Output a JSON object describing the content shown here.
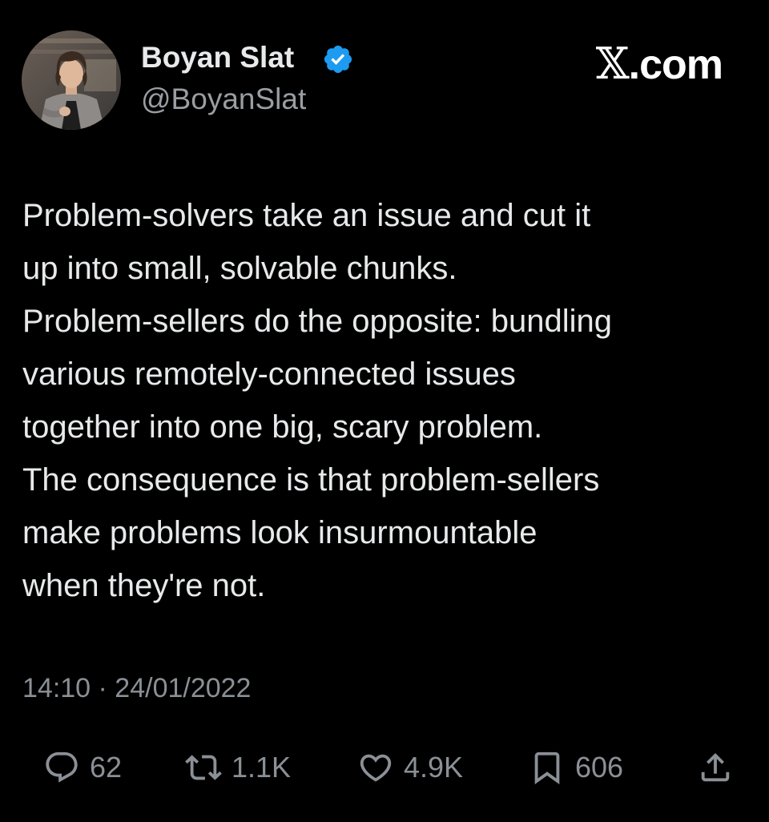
{
  "author": {
    "display_name": "Boyan Slat",
    "handle": "@BoyanSlat",
    "verified": true
  },
  "brand": {
    "logo_letter": "𝕏",
    "domain_suffix": ".com"
  },
  "tweet": {
    "lines": [
      "Problem-solvers take an issue and cut it",
      "up into small, solvable chunks.",
      "Problem-sellers do the opposite: bundling",
      "various remotely-connected issues",
      "together into one big, scary problem.",
      "The consequence is that problem-sellers",
      "make problems look insurmountable",
      "when they're not."
    ],
    "timestamp": "14:10 · 24/01/2022"
  },
  "actions": {
    "replies": "62",
    "retweets": "1.1K",
    "likes": "4.9K",
    "bookmarks": "606"
  },
  "icons": {
    "avatar": "avatar-photo",
    "verified": "verified-badge-icon",
    "reply": "reply-icon",
    "retweet": "retweet-icon",
    "like": "heart-icon",
    "bookmark": "bookmark-icon",
    "share": "share-icon"
  },
  "colors": {
    "background": "#000000",
    "text_primary": "#e7e9ea",
    "text_secondary": "#8b9096",
    "verified_blue": "#1d9bf0"
  }
}
